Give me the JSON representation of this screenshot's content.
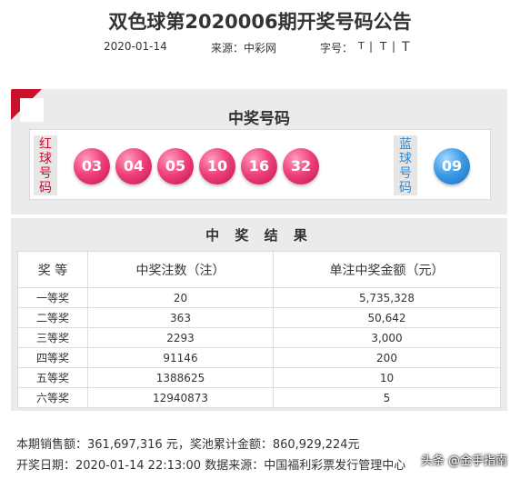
{
  "page": {
    "title": "双色球第2020006期开奖号码公告",
    "date": "2020-01-14",
    "source": "来源：中彩网",
    "font_label": "字号：",
    "font_sizes": [
      "T",
      "T",
      "T"
    ],
    "separator": "|"
  },
  "draw": {
    "heading": "中奖号码",
    "red_label": "红球号码",
    "blue_label": "蓝球号码",
    "red_balls": [
      "03",
      "04",
      "05",
      "10",
      "16",
      "32"
    ],
    "blue_balls": [
      "09"
    ]
  },
  "results": {
    "heading": "中 奖 结 果",
    "headers": [
      "奖 等",
      "中奖注数（注）",
      "单注中奖金额（元）"
    ],
    "rows": [
      [
        "一等奖",
        "20",
        "5,735,328"
      ],
      [
        "二等奖",
        "363",
        "50,642"
      ],
      [
        "三等奖",
        "2293",
        "3,000"
      ],
      [
        "四等奖",
        "91146",
        "200"
      ],
      [
        "五等奖",
        "1388625",
        "10"
      ],
      [
        "六等奖",
        "12940873",
        "5"
      ]
    ]
  },
  "footer": {
    "sales_line": "本期销售额：361,697,316 元，奖池累计金额：860,929,224元",
    "draw_line": "开奖日期：2020-01-14 22:13:00  数据来源：中国福利彩票发行管理中心"
  },
  "watermark": "头条 @金手指南",
  "colors": {
    "red_ball": "#e8336d",
    "blue_ball": "#3d9ce8",
    "red_label": "#d10a2c",
    "blue_label": "#2a8bd8",
    "ribbon": "#c9112b"
  }
}
